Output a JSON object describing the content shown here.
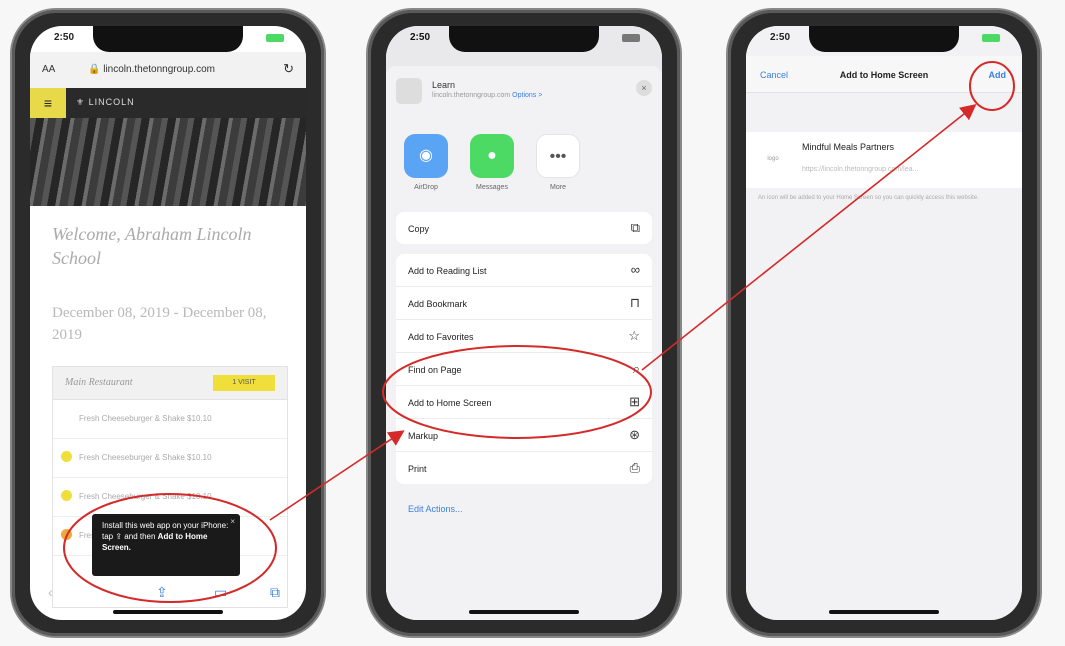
{
  "phone1": {
    "status_time": "2:50",
    "url_aa": "AA",
    "url": "lincoln.thetonngroup.com",
    "brand": "LINCOLN",
    "welcome": "Welcome, Abraham Lincoln School",
    "dates": "December 08, 2019 - December 08, 2019",
    "card_header": "Main Restaurant",
    "card_badge": "1 VISIT",
    "rows": [
      "Fresh Cheeseburger & Shake $10.10",
      "Fresh Cheeseburger & Shake $10.10",
      "Fresh Cheeseburger & Shake $10.10",
      "Fresh"
    ],
    "tooltip_pre": "Install this web app on your iPhone: tap",
    "tooltip_mid": "and then",
    "tooltip_bold": "Add to Home Screen.",
    "tooltip_close": "×",
    "toolbar_icons": [
      "back-icon",
      "share-icon",
      "bookmarks-icon",
      "tabs-icon"
    ]
  },
  "phone2": {
    "status_time": "2:50",
    "head_title": "Learn",
    "head_sub": "lincoln.thetonngroup.com",
    "head_options": "Options >",
    "close": "×",
    "apps": [
      {
        "label": "AirDrop",
        "color": "#5aa4f5",
        "glyph": "◉"
      },
      {
        "label": "Messages",
        "color": "#4cd964",
        "glyph": "●"
      },
      {
        "label": "More",
        "color": "#ffffff",
        "glyph": "•••"
      }
    ],
    "group1": [
      {
        "label": "Copy",
        "icon": "⧉"
      }
    ],
    "group2": [
      {
        "label": "Add to Reading List",
        "icon": "∞"
      },
      {
        "label": "Add Bookmark",
        "icon": "⊓"
      },
      {
        "label": "Add to Favorites",
        "icon": "☆"
      },
      {
        "label": "Find on Page",
        "icon": "⌕"
      },
      {
        "label": "Add to Home Screen",
        "icon": "⊞"
      },
      {
        "label": "Markup",
        "icon": "⊛"
      },
      {
        "label": "Print",
        "icon": "⎙"
      }
    ],
    "edit_actions": "Edit Actions..."
  },
  "phone3": {
    "status_time": "2:50",
    "cancel": "Cancel",
    "title": "Add to Home Screen",
    "add": "Add",
    "entry_name": "Mindful Meals Partners",
    "entry_url": "https://lincoln.thetonngroup.com/lea...",
    "entry_icon": "logo",
    "hint": "An icon will be added to your Home Screen so you can quickly access this website."
  },
  "colors": {
    "annotation": "#d42a2a",
    "ios_blue": "#3b7fe0",
    "accent_yellow": "#f0df3a"
  }
}
